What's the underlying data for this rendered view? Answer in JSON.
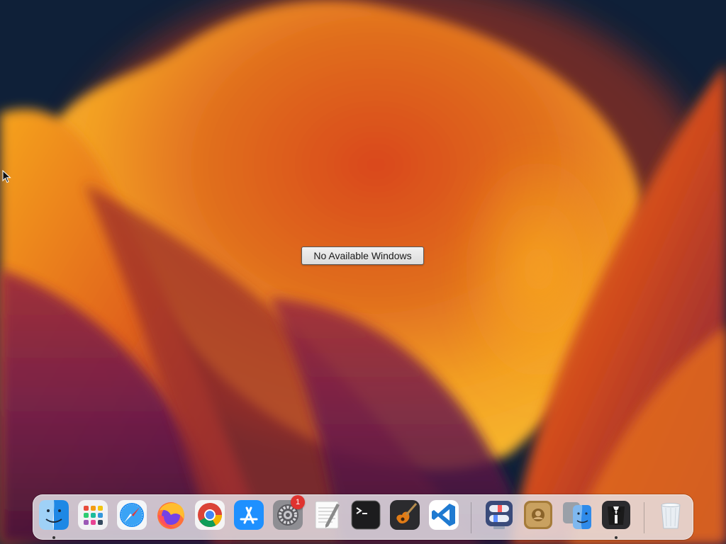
{
  "desktop": {
    "message": "No Available Windows"
  },
  "dock": {
    "apps": [
      {
        "name": "Finder",
        "icon": "finder-icon",
        "running": true
      },
      {
        "name": "Launchpad",
        "icon": "launchpad-icon",
        "running": false
      },
      {
        "name": "Safari",
        "icon": "safari-icon",
        "running": false
      },
      {
        "name": "Firefox",
        "icon": "firefox-icon",
        "running": false
      },
      {
        "name": "Google Chrome",
        "icon": "chrome-icon",
        "running": false
      },
      {
        "name": "App Store",
        "icon": "app-store-icon",
        "running": false
      },
      {
        "name": "System Settings",
        "icon": "system-settings-icon",
        "running": false,
        "badge": "1"
      },
      {
        "name": "TextEdit",
        "icon": "textedit-icon",
        "running": false
      },
      {
        "name": "Terminal",
        "icon": "terminal-icon",
        "running": false
      },
      {
        "name": "GarageBand",
        "icon": "garageband-icon",
        "running": false
      },
      {
        "name": "Visual Studio Code",
        "icon": "vscode-icon",
        "running": false
      },
      {
        "name": "Parallels Desktop",
        "icon": "parallels-icon",
        "running": false
      },
      {
        "name": "Directory Utility",
        "icon": "directory-utility-icon",
        "running": false
      },
      {
        "name": "Migration Assistant",
        "icon": "migration-assistant-icon",
        "running": false
      },
      {
        "name": "Bartender",
        "icon": "bartender-icon",
        "running": true
      },
      {
        "name": "Trash",
        "icon": "trash-icon",
        "running": false
      }
    ]
  },
  "colors": {
    "background": "#0f2038",
    "badge": "#e0332f",
    "dock": "#e8e6eb"
  }
}
